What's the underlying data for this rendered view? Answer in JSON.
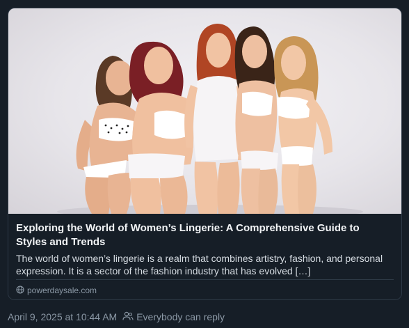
{
  "link_card": {
    "image_alt": "Five smiling women in white lingerie posing together",
    "title": "Exploring the World of Women’s Lingerie: A Comprehensive Guide to Styles and Trends",
    "description": "The world of women’s lingerie is a realm that combines artistry, fashion, and personal expression. It is a sector of the fashion industry that has evolved […]",
    "domain": "powerdaysale.com",
    "domain_icon": "globe-icon"
  },
  "post_meta": {
    "timestamp": "April 9, 2025 at 10:44 AM",
    "reply_setting": "Everybody can reply",
    "reply_icon": "people-icon"
  },
  "colors": {
    "background": "#161e27",
    "border": "#2e3a47",
    "title_text": "#f1f3f5",
    "body_text": "#d5dbe1",
    "muted_text": "#8b98a5"
  }
}
